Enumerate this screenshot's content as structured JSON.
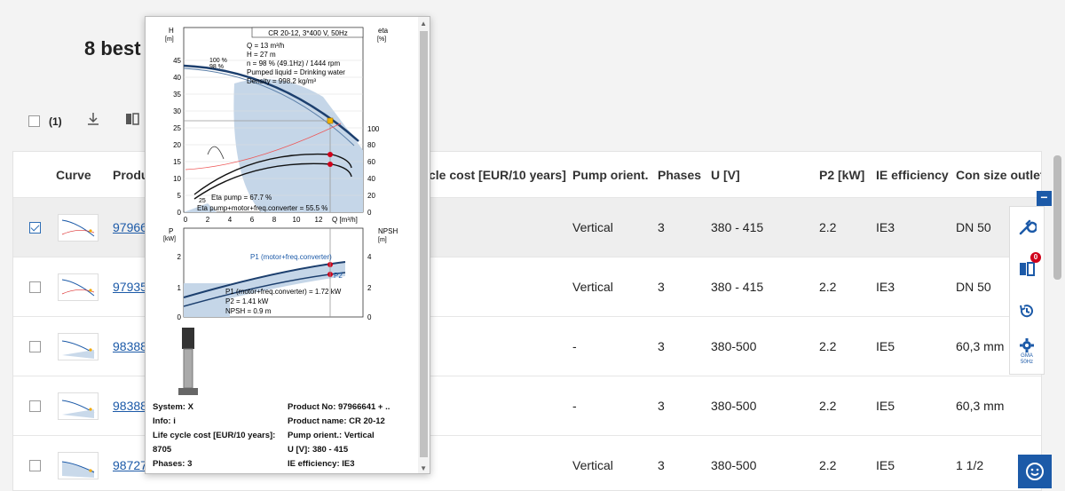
{
  "page": {
    "title": "8 best"
  },
  "toolbar": {
    "selected_count": "(1)"
  },
  "columns": {
    "curve": "Curve",
    "product": "Produ",
    "lcc": "cle cost [EUR/10 years]",
    "orient": "Pump orient.",
    "phases": "Phases",
    "u": "U [V]",
    "p2": "P2 [kW]",
    "ie": "IE efficiency",
    "con": "Con size outlet"
  },
  "rows": [
    {
      "selected": true,
      "product": "97966",
      "orient": "Vertical",
      "phases": "3",
      "u": "380 - 415",
      "p2": "2.2",
      "ie": "IE3",
      "con": "DN 50"
    },
    {
      "selected": false,
      "product": "97935",
      "orient": "Vertical",
      "phases": "3",
      "u": "380 - 415",
      "p2": "2.2",
      "ie": "IE3",
      "con": "DN 50"
    },
    {
      "selected": false,
      "product": "98388",
      "orient": "-",
      "phases": "3",
      "u": "380-500",
      "p2": "2.2",
      "ie": "IE5",
      "con": "60,3 mm"
    },
    {
      "selected": false,
      "product": "98388",
      "orient": "-",
      "phases": "3",
      "u": "380-500",
      "p2": "2.2",
      "ie": "IE5",
      "con": "60,3 mm"
    },
    {
      "selected": false,
      "product": "98727",
      "orient": "Vertical",
      "phases": "3",
      "u": "380-500",
      "p2": "2.2",
      "ie": "IE5",
      "con": "1 1/2"
    }
  ],
  "popup": {
    "chart": {
      "header": "CR 20-12, 3*400 V, 50Hz",
      "h_label": "H",
      "h_unit": "[m]",
      "eta_label": "eta",
      "eta_unit": "[%]",
      "q_line": "Q = 13 m³/h",
      "h_line": "H = 27 m",
      "n_line": "n = 98 % (49.1Hz) / 1444 rpm",
      "liquid_line": "Pumped liquid = Drinking water",
      "density_line": "Density = 998.2 kg/m³",
      "curve_100": "100 %",
      "curve_98": "98 %",
      "curve_25": "25",
      "eta_pump": "Eta pump = 67.7 %",
      "eta_total": "Eta pump+motor+freq.converter = 55.5 %",
      "q_axis": "Q [m³/h]",
      "h_ticks": [
        "45",
        "40",
        "35",
        "30",
        "25",
        "20",
        "15",
        "10",
        "5",
        "0"
      ],
      "eta_ticks": [
        "100",
        "80",
        "60",
        "40",
        "20",
        "0"
      ],
      "q_ticks": [
        "0",
        "2",
        "4",
        "6",
        "8",
        "10",
        "12"
      ],
      "p_label": "P",
      "p_unit": "[kW]",
      "npsh_label": "NPSH",
      "npsh_unit": "[m]",
      "p_ticks": [
        "2",
        "1",
        "0"
      ],
      "npsh_ticks": [
        "4",
        "2",
        "0"
      ],
      "p1_curve": "P1 (motor+freq.converter)",
      "p2_curve": "P2",
      "p1_value": "P1 (motor+freq.converter) = 1.72 kW",
      "p2_value": "P2 = 1.41 kW",
      "npsh_value": "NPSH = 0.9 m"
    },
    "info": {
      "system": "System: X",
      "info": "Info: i",
      "lcc_label": "Life cycle cost [EUR/10 years]:",
      "lcc_value": "8705",
      "phases": "Phases: 3",
      "product_no": "Product No: 97966641 + ..",
      "product_name": "Product name: CR 20-12",
      "orient": "Pump orient.: Vertical",
      "u": "U [V]: 380 - 415",
      "ie": "IE efficiency: IE3"
    }
  },
  "side": {
    "compare_badge": "0",
    "settings_label": "GMA",
    "settings_freq": "50Hz"
  },
  "colors": {
    "accent": "#1c5aa8",
    "badge": "#d0021b"
  }
}
